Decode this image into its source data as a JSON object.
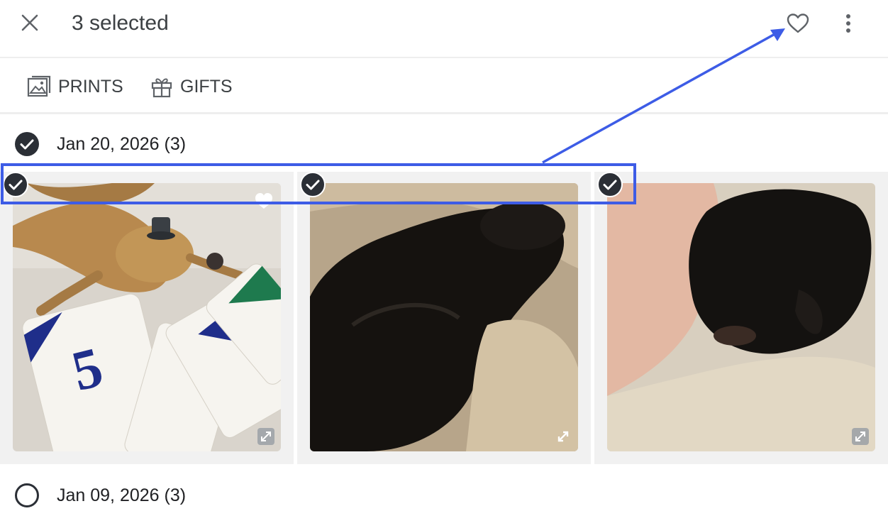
{
  "header": {
    "selected_label": "3 selected",
    "close_icon": "close-icon",
    "favorite_icon": "heart-outline-icon",
    "more_icon": "more-vert-icon"
  },
  "actions": [
    {
      "label": "PRINTS",
      "icon": "prints-icon"
    },
    {
      "label": "GIFTS",
      "icon": "gift-icon"
    }
  ],
  "groups": [
    {
      "date_label": "Jan 20, 2026 (3)",
      "selected": true,
      "photos": [
        {
          "subject": "bearded dragon with tiny hat on playing cards",
          "selected": true,
          "favorited": true
        },
        {
          "subject": "black puppies on fluffy fur",
          "selected": true,
          "favorited": false
        },
        {
          "subject": "black puppy in a hand",
          "selected": true,
          "favorited": false
        }
      ]
    },
    {
      "date_label": "Jan 09, 2026 (3)",
      "selected": false
    }
  ],
  "colors": {
    "annotation": "#3d5ce6",
    "check_fill": "#2b2f36",
    "text": "#202124"
  }
}
